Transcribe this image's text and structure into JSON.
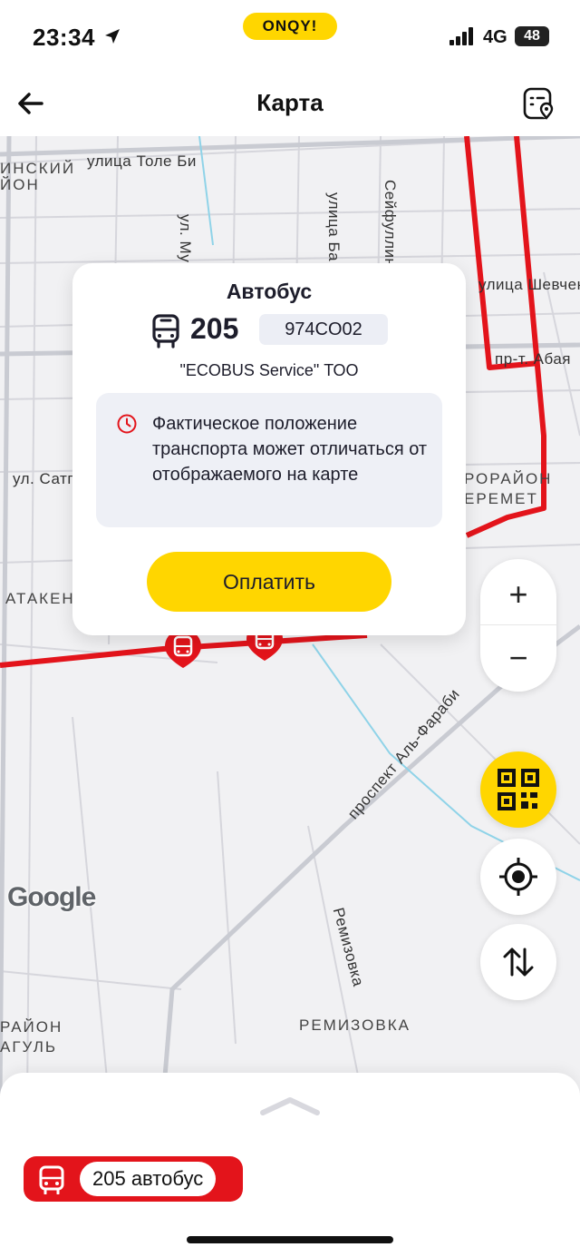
{
  "status_bar": {
    "time": "23:34",
    "brand": "ONQY!",
    "network": "4G",
    "battery": "48"
  },
  "header": {
    "title": "Карта"
  },
  "map": {
    "streets": [
      "улица Толе Би",
      "Сейфуллина",
      "улица Ба",
      "ул. Му",
      "улица Шевчен",
      "пр-т. Абая",
      "ул. Сатп",
      "проспект Аль-Фараби",
      "Ремизовка"
    ],
    "districts": [
      "ИНСКИЙ",
      "ЙОН",
      "РОРАЙОН",
      "ЕРЕМЕТ",
      "АТАКЕН",
      "РАЙОН",
      "АГУЛЬ",
      "РЕМИЗОВКА"
    ],
    "attribution": "Google",
    "route_color": "#E3141B"
  },
  "popup": {
    "vehicle_type": "Автобус",
    "route_number": "205",
    "plate": "974CO02",
    "operator": "\"ECOBUS Service\" ТОО",
    "warning": "Фактическое положение транспорта может отличаться от отображаемого на карте",
    "pay_label": "Оплатить"
  },
  "controls": {
    "zoom_in": "+",
    "zoom_out": "−"
  },
  "bottom_sheet": {
    "route_chip_label": "205 автобус"
  },
  "colors": {
    "accent": "#FFD600",
    "route": "#E3141B"
  }
}
